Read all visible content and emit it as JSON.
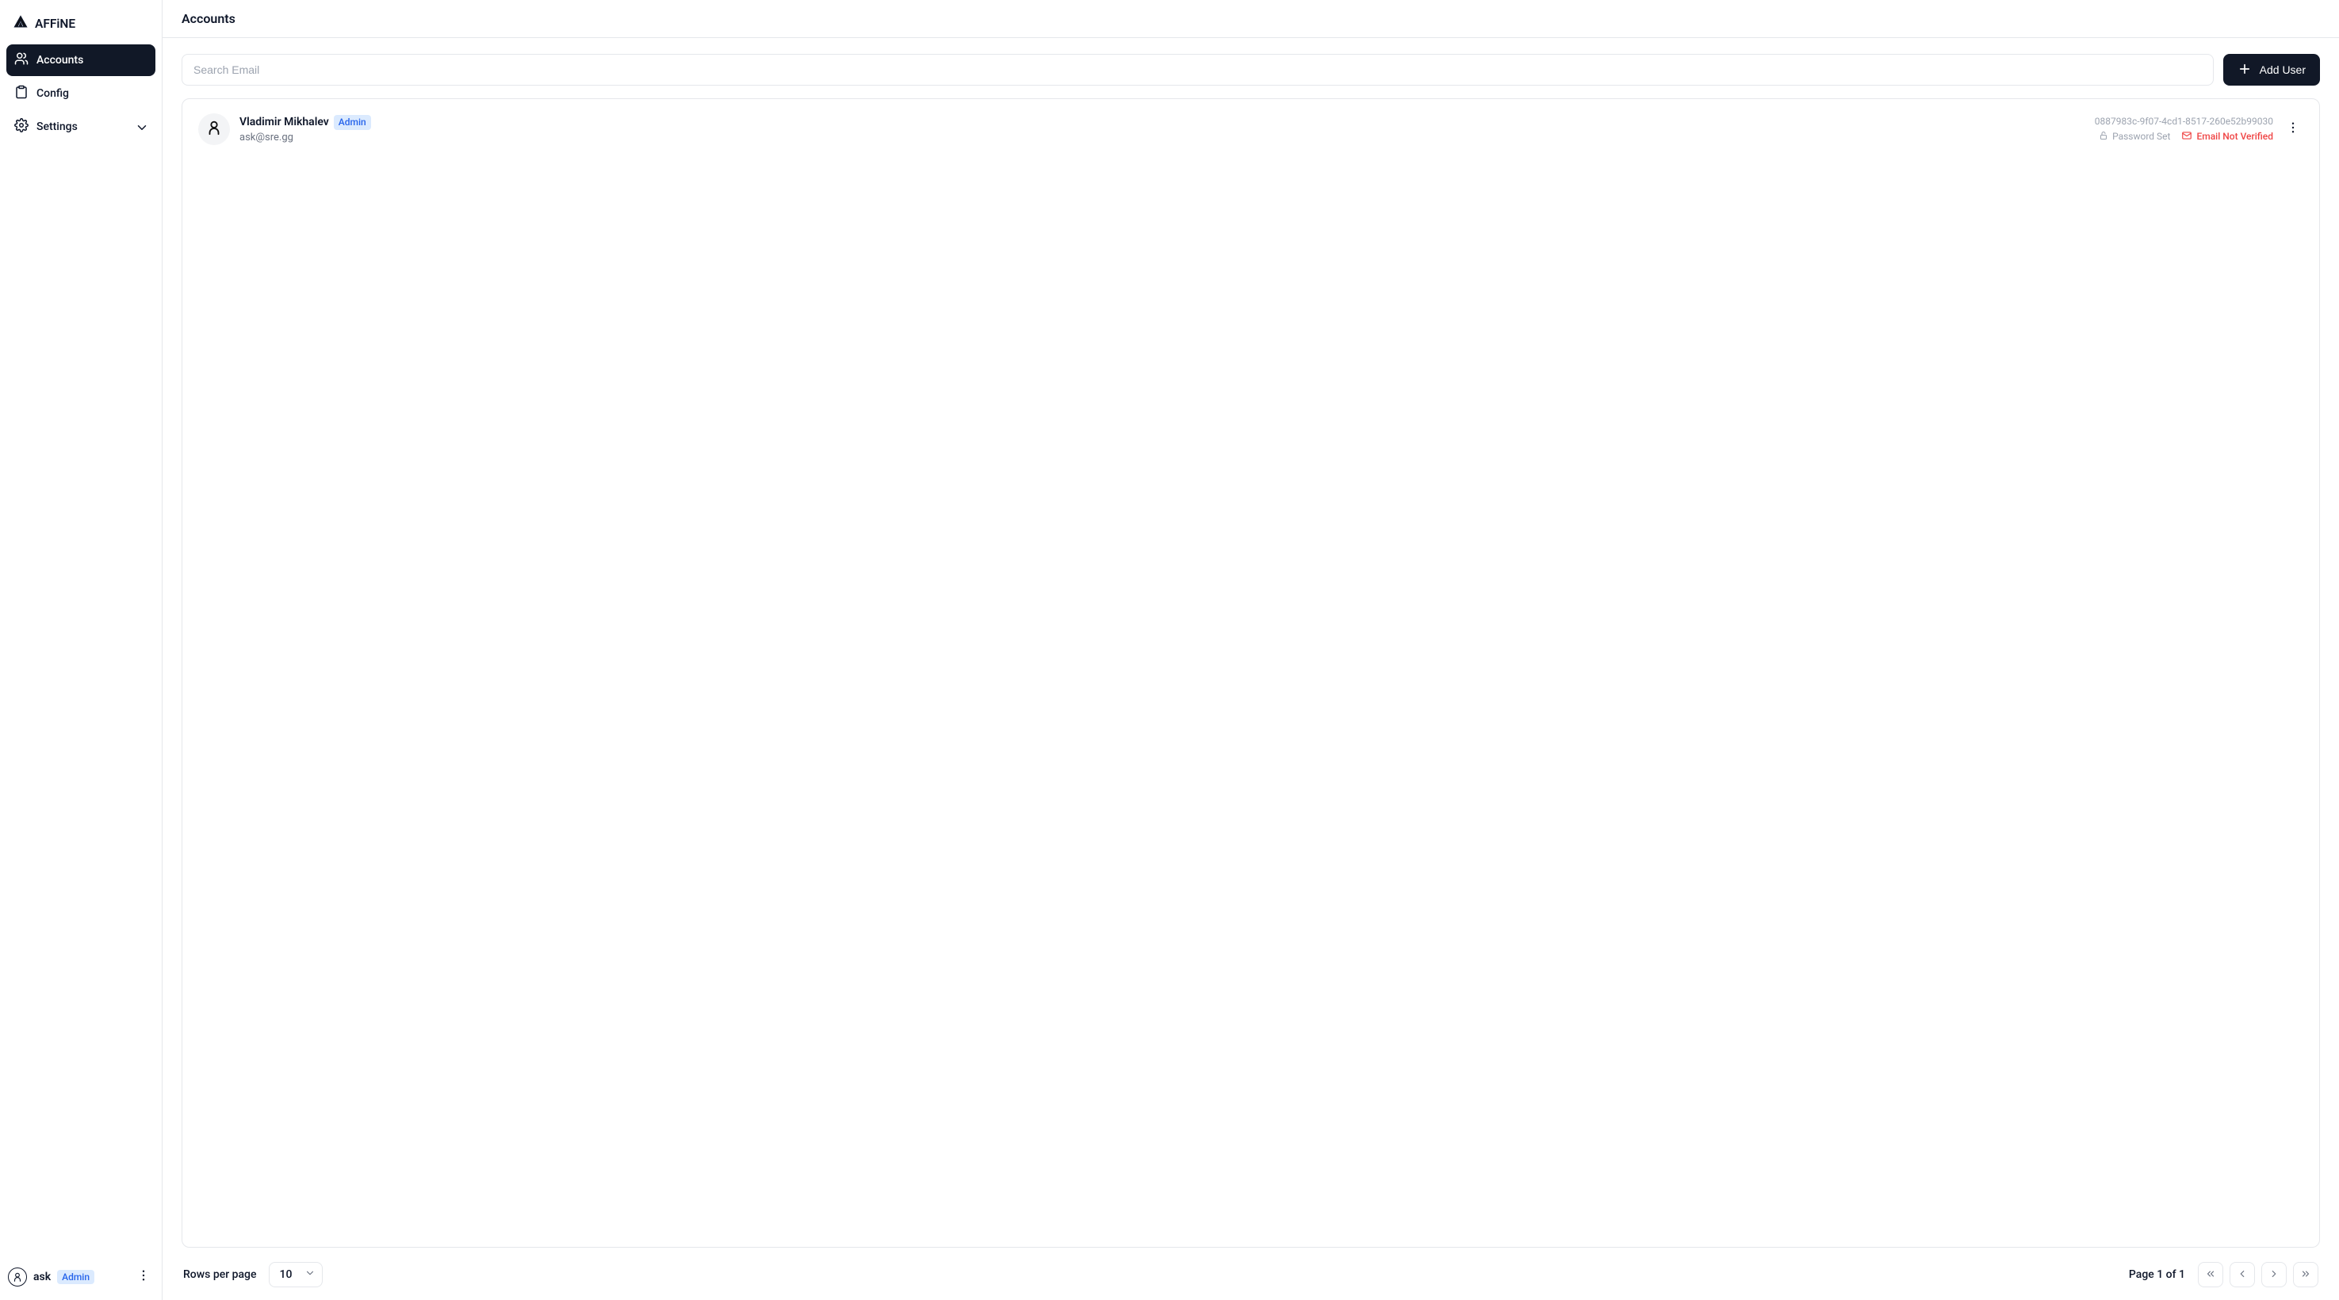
{
  "brand": {
    "name": "AFFiNE"
  },
  "sidebar": {
    "items": [
      {
        "label": "Accounts"
      },
      {
        "label": "Config"
      },
      {
        "label": "Settings"
      }
    ],
    "footer_user": {
      "name": "ask",
      "role": "Admin"
    }
  },
  "header": {
    "title": "Accounts"
  },
  "toolbar": {
    "search_placeholder": "Search Email",
    "add_label": "Add User"
  },
  "users": [
    {
      "name": "Vladimir Mikhalev",
      "role": "Admin",
      "email": "ask@sre.gg",
      "id": "0887983c-9f07-4cd1-8517-260e52b99030",
      "password_status": "Password Set",
      "email_status": "Email Not Verified"
    }
  ],
  "pagination": {
    "rows_label": "Rows per page",
    "rows_value": "10",
    "page_info": "Page 1 of 1"
  }
}
